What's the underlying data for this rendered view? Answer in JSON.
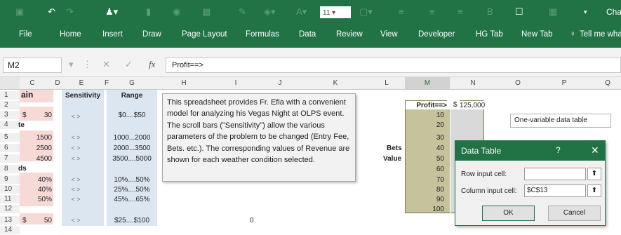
{
  "ribbon": {
    "font_size": "11",
    "tell_me_partial": "Cha",
    "tabs": [
      "File",
      "Home",
      "Insert",
      "Draw",
      "Page Layout",
      "Formulas",
      "Data",
      "Review",
      "View",
      "Developer",
      "HG Tab",
      "New Tab",
      "Tell me wha"
    ]
  },
  "formula_bar": {
    "name_box": "M2",
    "fx_label": "fx",
    "formula": "Profit==>"
  },
  "columns": [
    "C",
    "D",
    "E",
    "F",
    "G",
    "H",
    "I",
    "J",
    "K",
    "L",
    "M",
    "N",
    "O",
    "P",
    "Q"
  ],
  "rows": [
    "1",
    "2",
    "3",
    "4",
    "5",
    "6",
    "7",
    "8",
    "9",
    "10",
    "11",
    "12",
    "13",
    "14"
  ],
  "sheet": {
    "b1": "ain",
    "b4": "te",
    "b8": "ds",
    "dollar3": "$",
    "c3": "30",
    "c5": "1500",
    "c6": "2500",
    "c7": "4500",
    "c9": "40%",
    "c10": "40%",
    "c11": "50%",
    "dollar13": "$",
    "c13": "50",
    "e1": "Sensitivity",
    "g1": "Range",
    "g3": "$0....$50",
    "g5": "1000...2000",
    "g6": "2000...3500",
    "g7": "3500....5000",
    "g9": "10%....50%",
    "g10": "25%....50%",
    "g11": "45%....65%",
    "g13": "$25....$100",
    "i13": "0",
    "scroll": "< >",
    "bets_label": "Bets",
    "value_label": "Value",
    "m2": "Profit==>",
    "n2_dollar": "$",
    "n2": "125,000",
    "m_values": [
      "10",
      "20",
      "30",
      "40",
      "50",
      "60",
      "70",
      "80",
      "90",
      "100"
    ]
  },
  "textbox": "This spreadsheet provides Fr. Efia with a convenient model for analyzing his Vegas Night at OLPS event.  The scroll bars (\"Sensitivity\") allow the various parameters of the problem to be changed (Entry Fee, Bets. etc.).  The corresponding values of Revenue are shown for each weather condition selected.",
  "label_box": "One-variable data table",
  "dialog": {
    "title": "Data Table",
    "help": "?",
    "close": "✕",
    "row_label": "Row input cell:",
    "row_value": "",
    "col_label": "Column input cell:",
    "col_value": "$C$13",
    "ok": "OK",
    "cancel": "Cancel"
  },
  "colors": {
    "excel_green": "#217346",
    "pink": "#f7d9d6",
    "blue": "#dce6f1",
    "olive": "#c5c39c"
  }
}
